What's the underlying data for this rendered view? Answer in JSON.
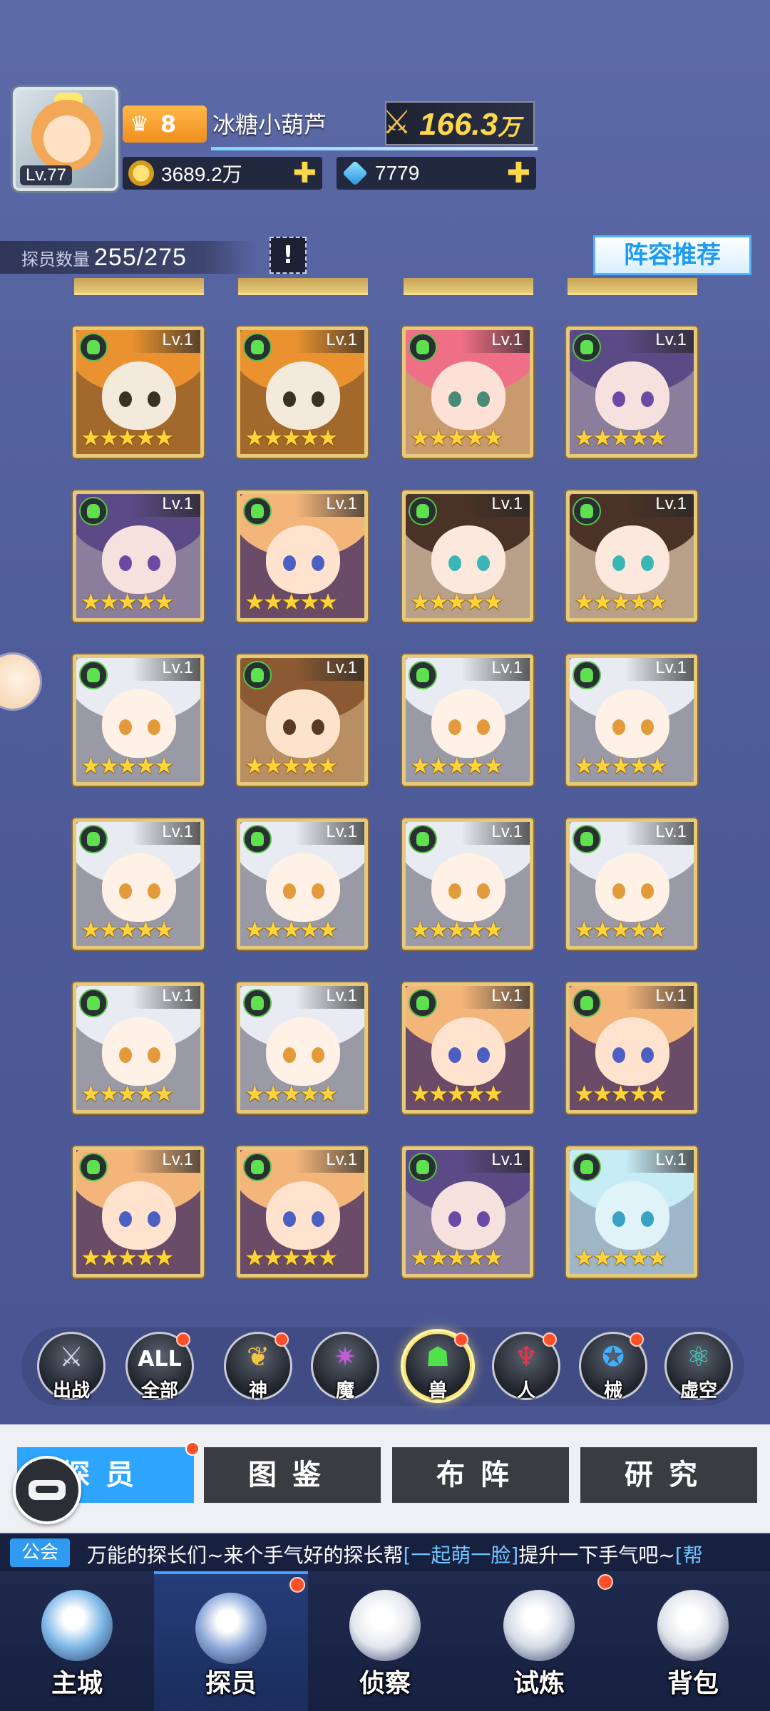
{
  "player": {
    "level_label": "Lv.77",
    "rank": "8",
    "name": "冰糖小葫芦",
    "power_value": "166.3",
    "power_unit": "万",
    "gold": "3689.2万",
    "gems": "7779"
  },
  "roster": {
    "count_label": "探员数量",
    "count_value": "255/275",
    "info_button": "!",
    "recommend_label": "阵容推荐"
  },
  "cards": [
    {
      "level": "Lv.1",
      "stars": "★★★★★",
      "theme": "tiger"
    },
    {
      "level": "Lv.1",
      "stars": "★★★★★",
      "theme": "tiger"
    },
    {
      "level": "Lv.1",
      "stars": "★★★★★",
      "theme": "pink"
    },
    {
      "level": "Lv.1",
      "stars": "★★★★★",
      "theme": "purple"
    },
    {
      "level": "Lv.1",
      "stars": "★★★★★",
      "theme": "purple"
    },
    {
      "level": "Lv.1",
      "stars": "★★★★★",
      "theme": "witch"
    },
    {
      "level": "Lv.1",
      "stars": "★★★★★",
      "theme": "panda"
    },
    {
      "level": "Lv.1",
      "stars": "★★★★★",
      "theme": "panda"
    },
    {
      "level": "Lv.1",
      "stars": "★★★★★",
      "theme": "silver"
    },
    {
      "level": "Lv.1",
      "stars": "★★★★★",
      "theme": "brown"
    },
    {
      "level": "Lv.1",
      "stars": "★★★★★",
      "theme": "silver"
    },
    {
      "level": "Lv.1",
      "stars": "★★★★★",
      "theme": "silver"
    },
    {
      "level": "Lv.1",
      "stars": "★★★★★",
      "theme": "silver"
    },
    {
      "level": "Lv.1",
      "stars": "★★★★★",
      "theme": "silver"
    },
    {
      "level": "Lv.1",
      "stars": "★★★★★",
      "theme": "silver"
    },
    {
      "level": "Lv.1",
      "stars": "★★★★★",
      "theme": "silver"
    },
    {
      "level": "Lv.1",
      "stars": "★★★★★",
      "theme": "silver"
    },
    {
      "level": "Lv.1",
      "stars": "★★★★★",
      "theme": "silver"
    },
    {
      "level": "Lv.1",
      "stars": "★★★★★",
      "theme": "witch"
    },
    {
      "level": "Lv.1",
      "stars": "★★★★★",
      "theme": "witch"
    },
    {
      "level": "Lv.1",
      "stars": "★★★★★",
      "theme": "witch"
    },
    {
      "level": "Lv.1",
      "stars": "★★★★★",
      "theme": "witch"
    },
    {
      "level": "Lv.1",
      "stars": "★★★★★",
      "theme": "purple"
    },
    {
      "level": "Lv.1",
      "stars": "★★★★★",
      "theme": "ice"
    }
  ],
  "filters": [
    {
      "label": "出战",
      "glyph": "⚔",
      "glow": "#cfd5de",
      "dot": false
    },
    {
      "label": "全部",
      "glyph": "ALL",
      "glow": "#ffffff",
      "dot": true
    },
    {
      "label": "神",
      "glyph": "❦",
      "glow": "#f4c442",
      "dot": true
    },
    {
      "label": "魔",
      "glyph": "✷",
      "glow": "#c35bd6",
      "dot": false
    },
    {
      "label": "兽",
      "glyph": "☗",
      "glow": "#4fe24a",
      "dot": true,
      "active": true
    },
    {
      "label": "人",
      "glyph": "♆",
      "glow": "#e8354b",
      "dot": true
    },
    {
      "label": "械",
      "glyph": "✪",
      "glow": "#3fb2ff",
      "dot": true
    },
    {
      "label": "虚空",
      "glyph": "⚛",
      "glow": "#3fe0c8",
      "dot": false
    }
  ],
  "tabs": [
    {
      "label": "探员",
      "active": true,
      "dot": true
    },
    {
      "label": "图鉴",
      "active": false,
      "dot": false
    },
    {
      "label": "布阵",
      "active": false,
      "dot": false
    },
    {
      "label": "研究",
      "active": false,
      "dot": false
    }
  ],
  "ticker": {
    "channel": "公会",
    "message_a": "万能的探长们~来个手气好的探长帮",
    "message_hl": "[一起萌一脸]",
    "message_b": "提升一下手气吧~",
    "message_c": "[帮"
  },
  "nav": [
    {
      "label": "主城",
      "color": "#7fb9e8",
      "dot": false
    },
    {
      "label": "探员",
      "color": "#8aa6d8",
      "dot": true,
      "active": true
    },
    {
      "label": "侦察",
      "color": "#e3e7ee",
      "dot": false
    },
    {
      "label": "试炼",
      "color": "#d4dbe6",
      "dot": true
    },
    {
      "label": "背包",
      "color": "#dfe3ea",
      "dot": false
    }
  ],
  "colors": {
    "accent": "#2ea6ff",
    "notification": "#ff4f2a",
    "star": "#ffd43a",
    "card_frame": "#e7c97c"
  }
}
